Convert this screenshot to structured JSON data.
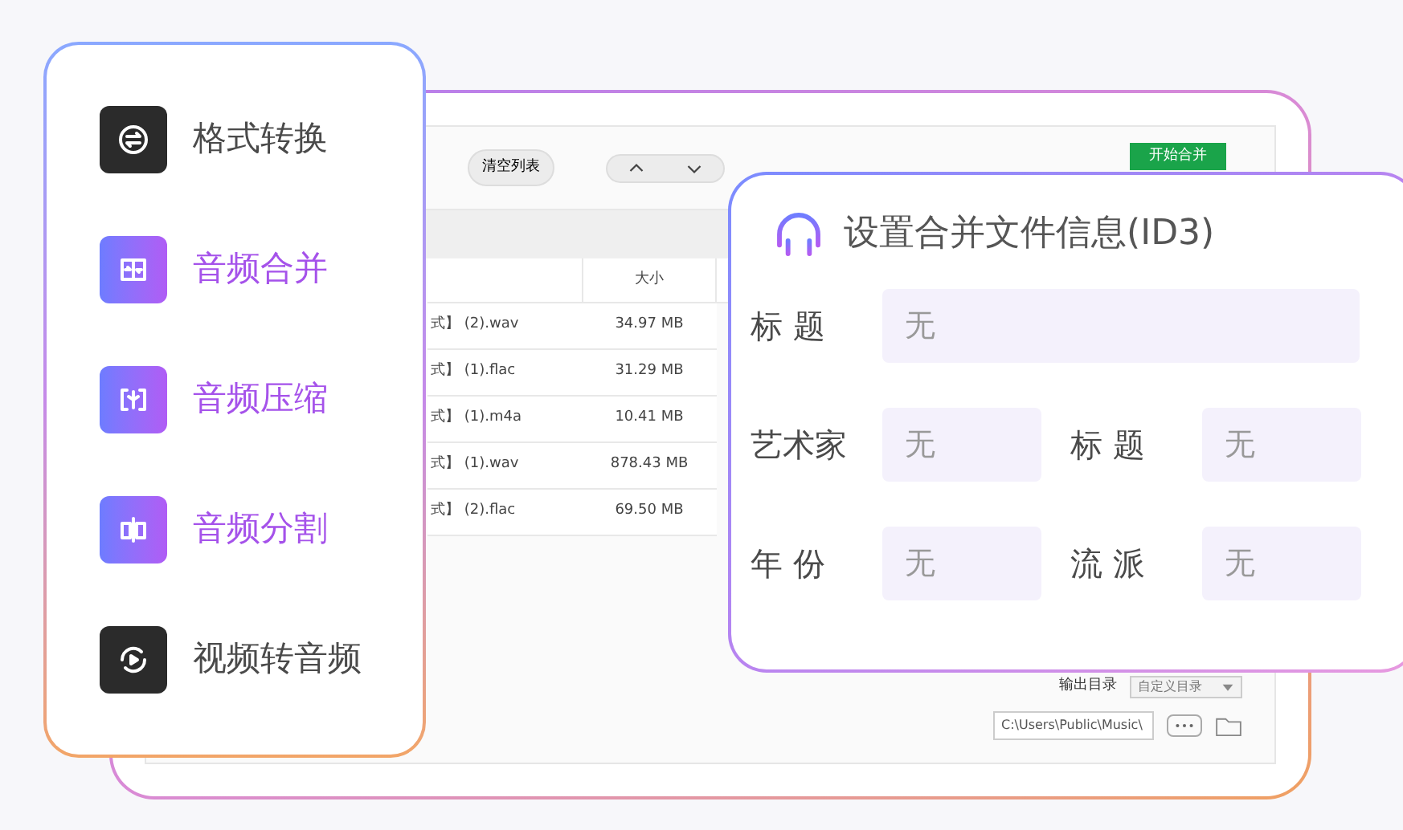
{
  "app_window": {
    "toolbar": {
      "clear_button": "清空列表",
      "start_button": "开始合并"
    },
    "table": {
      "columns": [
        "大小"
      ],
      "rows": [
        {
          "name": "式】 (2).wav",
          "size": "34.97 MB"
        },
        {
          "name": "式】 (1).flac",
          "size": "31.29 MB"
        },
        {
          "name": "式】 (1).m4a",
          "size": "10.41 MB"
        },
        {
          "name": "式】 (1).wav",
          "size": "878.43 MB"
        },
        {
          "name": "式】 (2).flac",
          "size": "69.50 MB"
        }
      ]
    },
    "output": {
      "label": "输出目录",
      "dropdown": "自定义目录",
      "path": "C:\\Users\\Public\\Music\\"
    }
  },
  "feature_menu": [
    {
      "label": "格式转换",
      "highlighted": false
    },
    {
      "label": "音频合并",
      "highlighted": true
    },
    {
      "label": "音频压缩",
      "highlighted": true
    },
    {
      "label": "音频分割",
      "highlighted": true
    },
    {
      "label": "视频转音频",
      "highlighted": false
    }
  ],
  "id3_panel": {
    "title": "设置合并文件信息(ID3)",
    "rows": [
      [
        {
          "label": "标 题",
          "value": "无"
        }
      ],
      [
        {
          "label": "艺术家",
          "value": "无"
        },
        {
          "label": "标 题",
          "value": "无"
        }
      ],
      [
        {
          "label": "年 份",
          "value": "无"
        },
        {
          "label": "流 派",
          "value": "无"
        }
      ]
    ]
  }
}
